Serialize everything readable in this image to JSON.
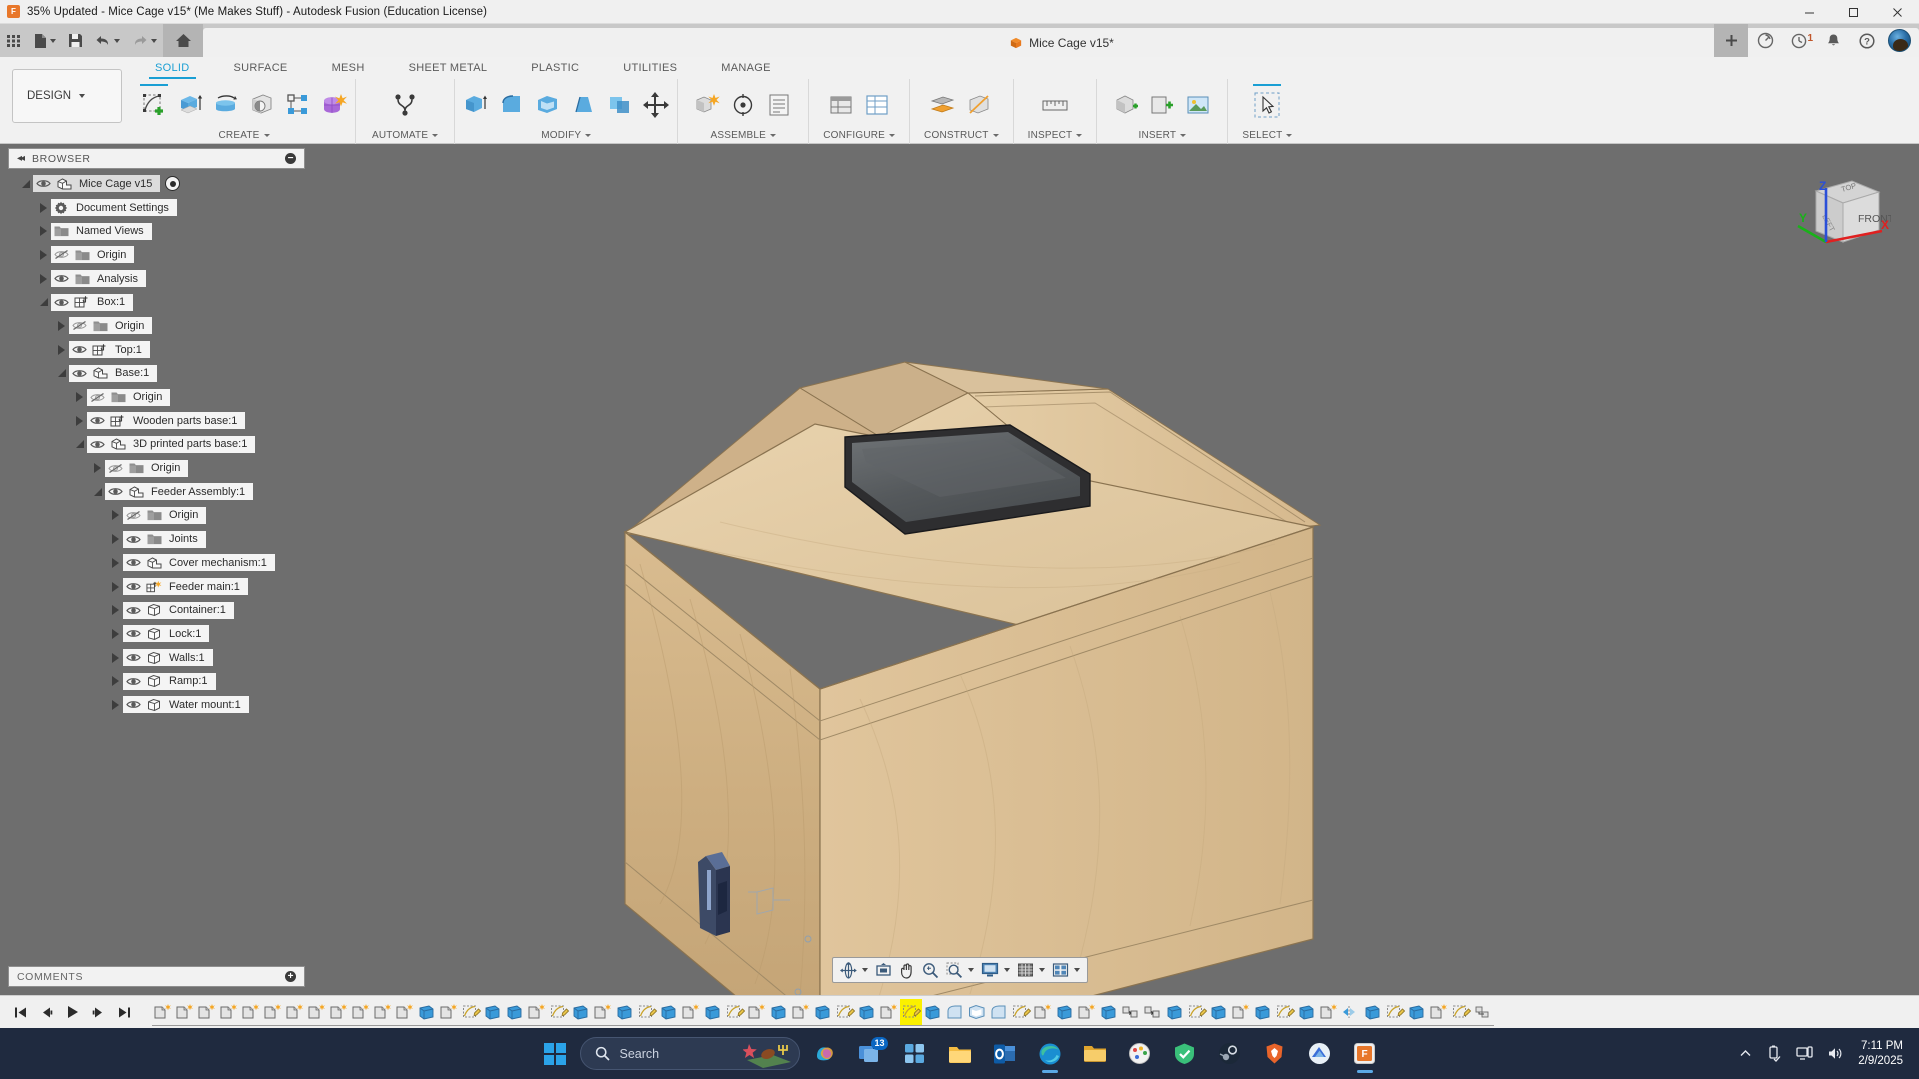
{
  "window": {
    "title": "35% Updated - Mice Cage v15* (Me Makes Stuff) - Autodesk Fusion (Education License)",
    "app_badge": "F",
    "minimize": "─",
    "maximize": "☐",
    "close": "✕"
  },
  "quick_access": [
    {
      "name": "app-grid-icon",
      "label": "Grid"
    },
    {
      "name": "new-file-icon",
      "label": "New"
    },
    {
      "name": "save-icon",
      "label": "Save"
    },
    {
      "name": "undo-icon",
      "label": "Undo"
    },
    {
      "name": "redo-icon",
      "label": "Redo"
    },
    {
      "name": "home-icon",
      "label": "Home"
    }
  ],
  "document_tab": {
    "title": "Mice Cage v15*",
    "close_label": "✕"
  },
  "topbar_right": {
    "add_tab": "+",
    "clock_badge": "1",
    "help": "?"
  },
  "ribbon": {
    "workspace": "DESIGN",
    "tabs": [
      {
        "label": "SOLID",
        "active": true
      },
      {
        "label": "SURFACE",
        "active": false
      },
      {
        "label": "MESH",
        "active": false
      },
      {
        "label": "SHEET METAL",
        "active": false
      },
      {
        "label": "PLASTIC",
        "active": false
      },
      {
        "label": "UTILITIES",
        "active": false
      },
      {
        "label": "MANAGE",
        "active": false
      }
    ],
    "groups": [
      {
        "label": "CREATE",
        "icons": [
          "new-sketch-icon",
          "extrude-icon",
          "revolve-icon",
          "hole-icon",
          "pattern-icon",
          "create-form-icon"
        ]
      },
      {
        "label": "AUTOMATE",
        "icons": [
          "automate-icon"
        ]
      },
      {
        "label": "MODIFY",
        "icons": [
          "press-pull-icon",
          "fillet-icon",
          "shell-icon",
          "draft-icon",
          "combine-icon",
          "move-copy-icon"
        ]
      },
      {
        "label": "ASSEMBLE",
        "icons": [
          "new-component-icon",
          "joint-icon",
          "assembly-list-icon"
        ]
      },
      {
        "label": "CONFIGURE",
        "icons": [
          "configure-icon",
          "config-table-icon"
        ]
      },
      {
        "label": "CONSTRUCT",
        "icons": [
          "offset-plane-icon",
          "axis-icon"
        ]
      },
      {
        "label": "INSPECT",
        "icons": [
          "measure-icon"
        ]
      },
      {
        "label": "INSERT",
        "icons": [
          "insert-derive-icon",
          "insert-mcmaster-icon",
          "insert-canvas-icon"
        ]
      },
      {
        "label": "SELECT",
        "icons": [
          "select-cursor-icon"
        ]
      }
    ]
  },
  "browser": {
    "header": "BROWSER",
    "collapse_icon": "◂◂",
    "minus": "−",
    "tree": [
      {
        "label": "Mice Cage v15",
        "depth": 0,
        "twist": "down",
        "eye": "visible",
        "icon": "component-icon",
        "root": true,
        "radio": true
      },
      {
        "label": "Document Settings",
        "depth": 1,
        "twist": "right",
        "eye": "none",
        "icon": "gear-icon"
      },
      {
        "label": "Named Views",
        "depth": 1,
        "twist": "right",
        "eye": "none",
        "icon": "folder-icon"
      },
      {
        "label": "Origin",
        "depth": 1,
        "twist": "right",
        "eye": "hidden",
        "icon": "folder-icon"
      },
      {
        "label": "Analysis",
        "depth": 1,
        "twist": "right",
        "eye": "visible",
        "icon": "folder-icon"
      },
      {
        "label": "Box:1",
        "depth": 1,
        "twist": "down",
        "eye": "visible",
        "icon": "component-anchor-icon"
      },
      {
        "label": "Origin",
        "depth": 2,
        "twist": "right",
        "eye": "hidden",
        "icon": "folder-icon"
      },
      {
        "label": "Top:1",
        "depth": 2,
        "twist": "right",
        "eye": "visible",
        "icon": "component-anchor-icon"
      },
      {
        "label": "Base:1",
        "depth": 2,
        "twist": "down",
        "eye": "visible",
        "icon": "component-icon"
      },
      {
        "label": "Origin",
        "depth": 3,
        "twist": "right",
        "eye": "hidden",
        "icon": "folder-icon"
      },
      {
        "label": "Wooden parts base:1",
        "depth": 3,
        "twist": "right",
        "eye": "visible",
        "icon": "component-anchor-icon"
      },
      {
        "label": "3D printed parts base:1",
        "depth": 3,
        "twist": "down",
        "eye": "visible",
        "icon": "component-icon"
      },
      {
        "label": "Origin",
        "depth": 4,
        "twist": "right",
        "eye": "hidden",
        "icon": "folder-icon"
      },
      {
        "label": "Feeder Assembly:1",
        "depth": 4,
        "twist": "down",
        "eye": "visible",
        "icon": "component-icon"
      },
      {
        "label": "Origin",
        "depth": 5,
        "twist": "right",
        "eye": "hidden",
        "icon": "folder-icon"
      },
      {
        "label": "Joints",
        "depth": 5,
        "twist": "right",
        "eye": "visible",
        "icon": "folder-icon"
      },
      {
        "label": "Cover mechanism:1",
        "depth": 5,
        "twist": "right",
        "eye": "visible",
        "icon": "component-icon"
      },
      {
        "label": "Feeder main:1",
        "depth": 5,
        "twist": "right",
        "eye": "visible",
        "icon": "component-new-icon"
      },
      {
        "label": "Container:1",
        "depth": 5,
        "twist": "right",
        "eye": "visible",
        "icon": "body-icon"
      },
      {
        "label": "Lock:1",
        "depth": 5,
        "twist": "right",
        "eye": "visible",
        "icon": "body-icon"
      },
      {
        "label": "Walls:1",
        "depth": 5,
        "twist": "right",
        "eye": "visible",
        "icon": "body-icon"
      },
      {
        "label": "Ramp:1",
        "depth": 5,
        "twist": "right",
        "eye": "visible",
        "icon": "body-icon"
      },
      {
        "label": "Water mount:1",
        "depth": 5,
        "twist": "right",
        "eye": "visible",
        "icon": "body-icon"
      }
    ]
  },
  "viewcube": {
    "front": "FRONT",
    "top": "TOP",
    "left": "LEFT",
    "axis_x": "X",
    "axis_y": "Y",
    "axis_z": "Z",
    "color_x": "#e02020",
    "color_y": "#19b219",
    "color_z": "#2a4fd8"
  },
  "navbar": [
    {
      "name": "orbit-icon",
      "dropdown": true
    },
    {
      "name": "fit-view-icon",
      "dropdown": false
    },
    {
      "name": "pan-icon",
      "dropdown": false
    },
    {
      "name": "zoom-icon",
      "dropdown": false
    },
    {
      "name": "zoom-window-icon",
      "dropdown": true
    },
    {
      "name": "display-settings-icon",
      "dropdown": true
    },
    {
      "name": "grid-snap-icon",
      "dropdown": true
    },
    {
      "name": "viewport-layout-icon",
      "dropdown": true
    }
  ],
  "comments": {
    "header": "COMMENTS",
    "add": "+"
  },
  "timeline": {
    "controls": [
      "go-to-start-icon",
      "step-back-icon",
      "play-icon",
      "step-forward-icon",
      "go-to-end-icon"
    ],
    "selected_index": 34,
    "items": [
      "component-new-icon",
      "component-new-icon",
      "component-new-icon",
      "component-new-icon",
      "component-new-icon",
      "component-new-icon",
      "component-new-icon",
      "component-new-icon",
      "component-new-icon",
      "component-new-icon",
      "component-new-icon",
      "component-new-icon",
      "extrude-icon",
      "component-new-icon",
      "sketch-icon",
      "extrude-icon",
      "extrude-icon",
      "component-new-icon",
      "sketch-icon",
      "extrude-icon",
      "component-new-icon",
      "extrude-icon",
      "sketch-icon",
      "extrude-icon",
      "component-new-icon",
      "extrude-icon",
      "sketch-icon",
      "component-new-icon",
      "extrude-icon",
      "component-new-icon",
      "extrude-icon",
      "sketch-icon",
      "extrude-icon",
      "component-new-icon",
      "sketch-icon",
      "extrude-icon",
      "fillet-icon",
      "shell-icon",
      "fillet-icon",
      "sketch-icon",
      "component-new-icon",
      "extrude-icon",
      "component-new-icon",
      "extrude-icon",
      "joint-icon",
      "joint-icon",
      "extrude-icon",
      "sketch-icon",
      "extrude-icon",
      "component-new-icon",
      "extrude-icon",
      "sketch-icon",
      "extrude-icon",
      "component-new-icon",
      "mirror-icon",
      "extrude-icon",
      "sketch-icon",
      "extrude-icon",
      "component-new-icon",
      "sketch-icon",
      "gear-icon"
    ]
  },
  "taskbar": {
    "search_placeholder": "Search",
    "taskview_badge": "13",
    "clock_time": "7:11 PM",
    "clock_date": "2/9/2025",
    "chevron": "⌃",
    "apps": [
      {
        "name": "start-button"
      },
      {
        "name": "copilot-icon"
      },
      {
        "name": "task-view-icon"
      },
      {
        "name": "widgets-icon"
      },
      {
        "name": "file-explorer-icon"
      },
      {
        "name": "outlook-icon"
      },
      {
        "name": "edge-icon"
      },
      {
        "name": "folder-icon"
      },
      {
        "name": "paint-icon"
      },
      {
        "name": "vpn-icon"
      },
      {
        "name": "steam-icon"
      },
      {
        "name": "brave-icon"
      },
      {
        "name": "autodesk-icon"
      },
      {
        "name": "fusion-icon"
      }
    ]
  }
}
